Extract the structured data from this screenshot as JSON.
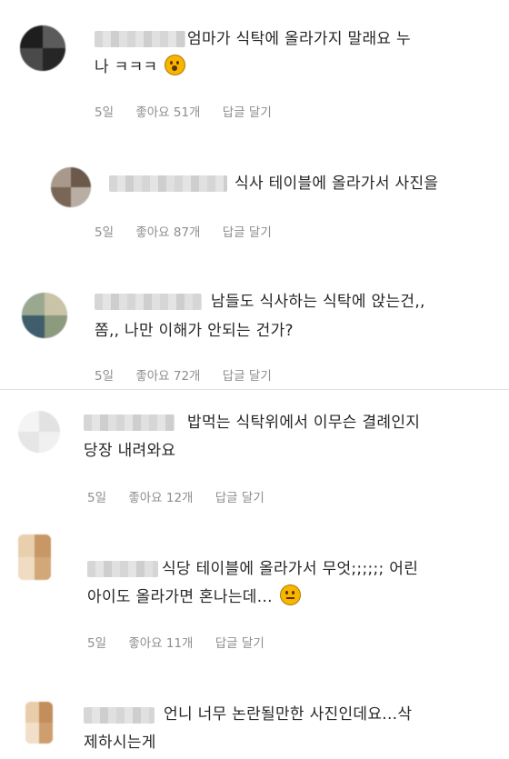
{
  "comments": [
    {
      "line1": "엄마가 식탁에 올라가지 말래요 누",
      "line2": "나 ㅋㅋㅋ",
      "emoji": "astonished-face-icon",
      "time": "5일",
      "likes": "좋아요 51개",
      "reply": "답글 달기"
    },
    {
      "line1": "식사 테이블에 올라가서 사진을",
      "line2": "",
      "time": "5일",
      "likes": "좋아요 87개",
      "reply": "답글 달기"
    },
    {
      "line1": "남들도 식사하는 식탁에 앉는건,,",
      "line2": "쫌,, 나만 이해가 안되는 건가?",
      "time": "5일",
      "likes": "좋아요 72개",
      "reply": "답글 달기"
    },
    {
      "line1": "밥먹는 식탁위에서 이무슨 결례인지",
      "line2": "당장 내려와요",
      "time": "5일",
      "likes": "좋아요 12개",
      "reply": "답글 달기"
    },
    {
      "line1": "식당 테이블에 올라가서 무엇;;;;;; 어린",
      "line2": "아이도 올라가면 혼나는데...",
      "emoji": "neutral-face-icon",
      "time": "5일",
      "likes": "좋아요 11개",
      "reply": "답글 달기"
    },
    {
      "line1": "언니 너무 논란될만한 사진인데요...삭",
      "line2": "제하시는게"
    }
  ]
}
